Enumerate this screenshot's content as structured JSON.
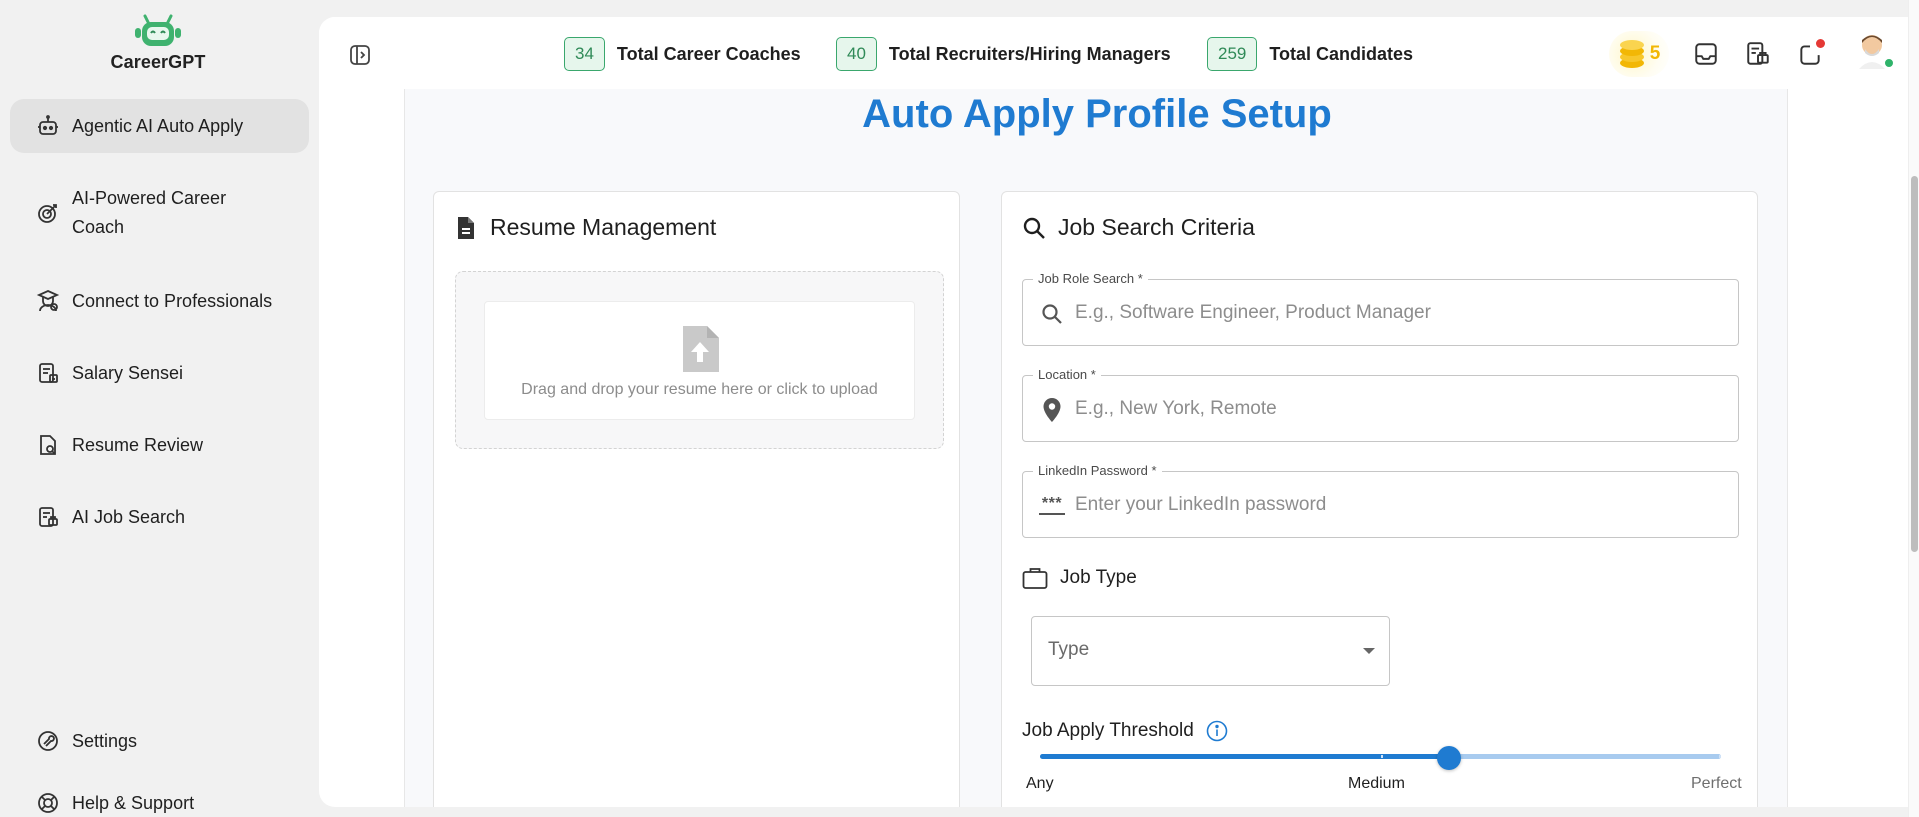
{
  "app": {
    "name": "CareerGPT"
  },
  "colors": {
    "accent": "#1f7bd1",
    "badge_green": "#3aa76d",
    "coin_gold": "#f2b705",
    "notification": "#e53935",
    "online": "#2fb36a"
  },
  "sidebar": {
    "items": [
      {
        "label": "Agentic AI Auto Apply",
        "icon": "robot-icon",
        "active": true
      },
      {
        "label": "AI-Powered Career Coach",
        "icon": "target-icon",
        "active": false
      },
      {
        "label": "Connect to Professionals",
        "icon": "graduate-icon",
        "active": false
      },
      {
        "label": "Salary Sensei",
        "icon": "salary-report-icon",
        "active": false
      },
      {
        "label": "Resume Review",
        "icon": "resume-search-icon",
        "active": false
      },
      {
        "label": "AI Job Search",
        "icon": "job-search-icon",
        "active": false
      }
    ],
    "footer": [
      {
        "label": "Settings",
        "icon": "settings-icon"
      },
      {
        "label": "Help & Support",
        "icon": "lifebuoy-icon"
      }
    ]
  },
  "header": {
    "stats": [
      {
        "count": "34",
        "label": "Total Career Coaches"
      },
      {
        "count": "40",
        "label": "Total Recruiters/Hiring Managers"
      },
      {
        "count": "259",
        "label": "Total Candidates"
      }
    ],
    "coins": "5",
    "icons": [
      "inbox-icon",
      "job-board-icon",
      "notification-icon",
      "user-avatar"
    ]
  },
  "page": {
    "title": "Auto Apply Profile Setup"
  },
  "resume": {
    "title": "Resume Management",
    "dropzone_text": "Drag and drop your resume here or click to upload"
  },
  "criteria": {
    "title": "Job Search Criteria",
    "job_role": {
      "label": "Job Role Search *",
      "placeholder": "E.g., Software Engineer, Product Manager",
      "value": ""
    },
    "location": {
      "label": "Location *",
      "placeholder": "E.g., New York, Remote",
      "value": ""
    },
    "linkedin_password": {
      "label": "LinkedIn Password *",
      "placeholder": "Enter your LinkedIn password",
      "value": "",
      "icon_text": "***"
    },
    "job_type": {
      "heading": "Job Type",
      "placeholder": "Type"
    },
    "threshold": {
      "heading": "Job Apply Threshold",
      "value_fraction": 0.6,
      "labels": {
        "min": "Any",
        "mid": "Medium",
        "max": "Perfect"
      }
    }
  }
}
